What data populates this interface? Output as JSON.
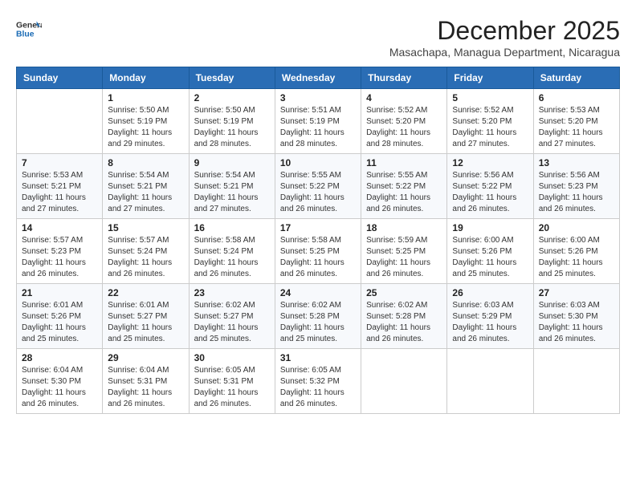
{
  "header": {
    "logo_line1": "General",
    "logo_line2": "Blue",
    "month_title": "December 2025",
    "location": "Masachapa, Managua Department, Nicaragua"
  },
  "weekdays": [
    "Sunday",
    "Monday",
    "Tuesday",
    "Wednesday",
    "Thursday",
    "Friday",
    "Saturday"
  ],
  "weeks": [
    [
      {
        "day": "",
        "info": ""
      },
      {
        "day": "1",
        "info": "Sunrise: 5:50 AM\nSunset: 5:19 PM\nDaylight: 11 hours\nand 29 minutes."
      },
      {
        "day": "2",
        "info": "Sunrise: 5:50 AM\nSunset: 5:19 PM\nDaylight: 11 hours\nand 28 minutes."
      },
      {
        "day": "3",
        "info": "Sunrise: 5:51 AM\nSunset: 5:19 PM\nDaylight: 11 hours\nand 28 minutes."
      },
      {
        "day": "4",
        "info": "Sunrise: 5:52 AM\nSunset: 5:20 PM\nDaylight: 11 hours\nand 28 minutes."
      },
      {
        "day": "5",
        "info": "Sunrise: 5:52 AM\nSunset: 5:20 PM\nDaylight: 11 hours\nand 27 minutes."
      },
      {
        "day": "6",
        "info": "Sunrise: 5:53 AM\nSunset: 5:20 PM\nDaylight: 11 hours\nand 27 minutes."
      }
    ],
    [
      {
        "day": "7",
        "info": "Sunrise: 5:53 AM\nSunset: 5:21 PM\nDaylight: 11 hours\nand 27 minutes."
      },
      {
        "day": "8",
        "info": "Sunrise: 5:54 AM\nSunset: 5:21 PM\nDaylight: 11 hours\nand 27 minutes."
      },
      {
        "day": "9",
        "info": "Sunrise: 5:54 AM\nSunset: 5:21 PM\nDaylight: 11 hours\nand 27 minutes."
      },
      {
        "day": "10",
        "info": "Sunrise: 5:55 AM\nSunset: 5:22 PM\nDaylight: 11 hours\nand 26 minutes."
      },
      {
        "day": "11",
        "info": "Sunrise: 5:55 AM\nSunset: 5:22 PM\nDaylight: 11 hours\nand 26 minutes."
      },
      {
        "day": "12",
        "info": "Sunrise: 5:56 AM\nSunset: 5:22 PM\nDaylight: 11 hours\nand 26 minutes."
      },
      {
        "day": "13",
        "info": "Sunrise: 5:56 AM\nSunset: 5:23 PM\nDaylight: 11 hours\nand 26 minutes."
      }
    ],
    [
      {
        "day": "14",
        "info": "Sunrise: 5:57 AM\nSunset: 5:23 PM\nDaylight: 11 hours\nand 26 minutes."
      },
      {
        "day": "15",
        "info": "Sunrise: 5:57 AM\nSunset: 5:24 PM\nDaylight: 11 hours\nand 26 minutes."
      },
      {
        "day": "16",
        "info": "Sunrise: 5:58 AM\nSunset: 5:24 PM\nDaylight: 11 hours\nand 26 minutes."
      },
      {
        "day": "17",
        "info": "Sunrise: 5:58 AM\nSunset: 5:25 PM\nDaylight: 11 hours\nand 26 minutes."
      },
      {
        "day": "18",
        "info": "Sunrise: 5:59 AM\nSunset: 5:25 PM\nDaylight: 11 hours\nand 26 minutes."
      },
      {
        "day": "19",
        "info": "Sunrise: 6:00 AM\nSunset: 5:26 PM\nDaylight: 11 hours\nand 25 minutes."
      },
      {
        "day": "20",
        "info": "Sunrise: 6:00 AM\nSunset: 5:26 PM\nDaylight: 11 hours\nand 25 minutes."
      }
    ],
    [
      {
        "day": "21",
        "info": "Sunrise: 6:01 AM\nSunset: 5:26 PM\nDaylight: 11 hours\nand 25 minutes."
      },
      {
        "day": "22",
        "info": "Sunrise: 6:01 AM\nSunset: 5:27 PM\nDaylight: 11 hours\nand 25 minutes."
      },
      {
        "day": "23",
        "info": "Sunrise: 6:02 AM\nSunset: 5:27 PM\nDaylight: 11 hours\nand 25 minutes."
      },
      {
        "day": "24",
        "info": "Sunrise: 6:02 AM\nSunset: 5:28 PM\nDaylight: 11 hours\nand 25 minutes."
      },
      {
        "day": "25",
        "info": "Sunrise: 6:02 AM\nSunset: 5:28 PM\nDaylight: 11 hours\nand 26 minutes."
      },
      {
        "day": "26",
        "info": "Sunrise: 6:03 AM\nSunset: 5:29 PM\nDaylight: 11 hours\nand 26 minutes."
      },
      {
        "day": "27",
        "info": "Sunrise: 6:03 AM\nSunset: 5:30 PM\nDaylight: 11 hours\nand 26 minutes."
      }
    ],
    [
      {
        "day": "28",
        "info": "Sunrise: 6:04 AM\nSunset: 5:30 PM\nDaylight: 11 hours\nand 26 minutes."
      },
      {
        "day": "29",
        "info": "Sunrise: 6:04 AM\nSunset: 5:31 PM\nDaylight: 11 hours\nand 26 minutes."
      },
      {
        "day": "30",
        "info": "Sunrise: 6:05 AM\nSunset: 5:31 PM\nDaylight: 11 hours\nand 26 minutes."
      },
      {
        "day": "31",
        "info": "Sunrise: 6:05 AM\nSunset: 5:32 PM\nDaylight: 11 hours\nand 26 minutes."
      },
      {
        "day": "",
        "info": ""
      },
      {
        "day": "",
        "info": ""
      },
      {
        "day": "",
        "info": ""
      }
    ]
  ]
}
